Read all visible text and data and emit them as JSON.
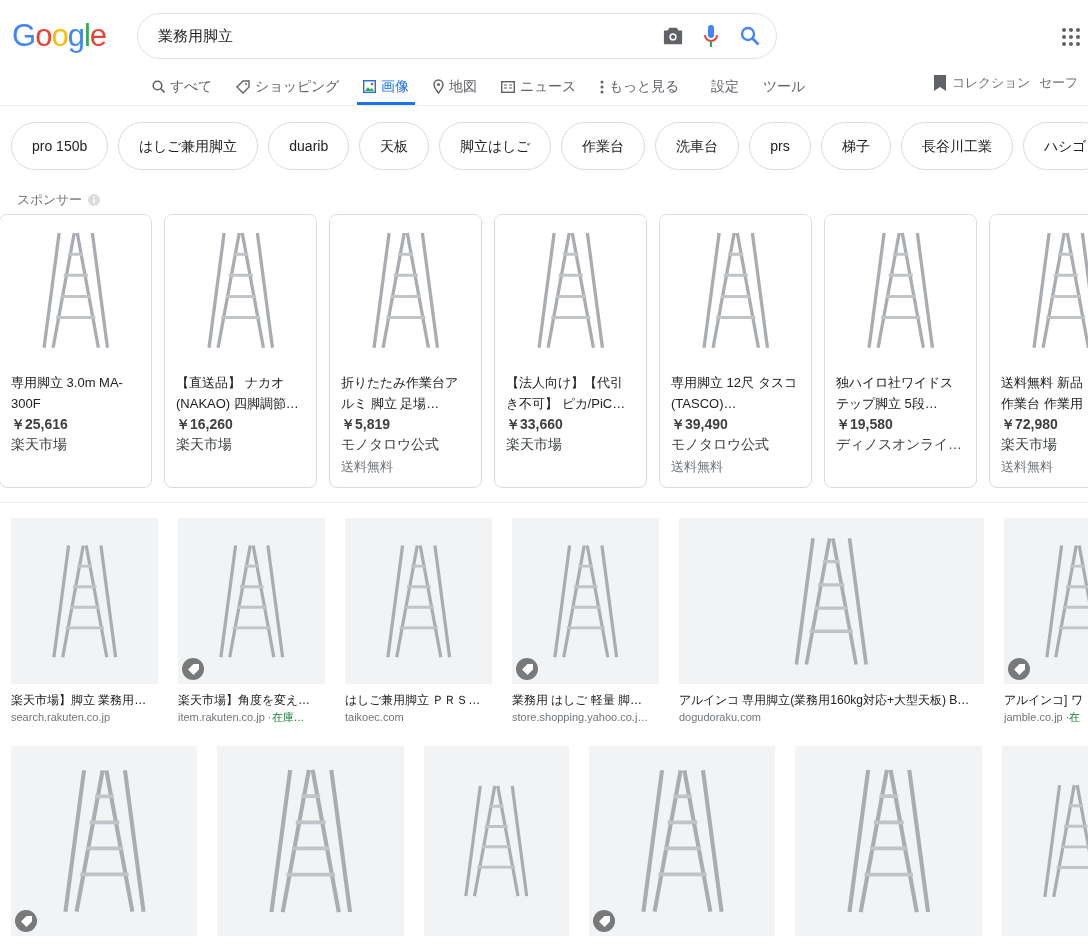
{
  "logo": "Google",
  "search": {
    "value": "業務用脚立"
  },
  "tabs": [
    {
      "label": "すべて",
      "selected": false
    },
    {
      "label": "ショッピング",
      "selected": false
    },
    {
      "label": "画像",
      "selected": true
    },
    {
      "label": "地図",
      "selected": false
    },
    {
      "label": "ニュース",
      "selected": false
    },
    {
      "label": "もっと見る",
      "selected": false
    },
    {
      "label": "設定",
      "selected": false
    },
    {
      "label": "ツール",
      "selected": false
    }
  ],
  "collections": "コレクション",
  "safesearch": "セーフ",
  "chips": [
    "pro 150b",
    "はしご兼用脚立",
    "duarib",
    "天板",
    "脚立はしご",
    "作業台",
    "洗車台",
    "prs",
    "梯子",
    "長谷川工業",
    "ハシゴ"
  ],
  "sponsored_label": "スポンサー",
  "sponsored": [
    {
      "title": "専用脚立 3.0m MA-300F",
      "price": "￥25,616",
      "store": "楽天市場"
    },
    {
      "title": "【直送品】 ナカオ (NAKAO) 四脚調節…",
      "price": "￥16,260",
      "store": "楽天市場"
    },
    {
      "title": "折りたたみ作業台アルミ 脚立 足場…",
      "price": "￥5,819",
      "store": "モノタロウ公式",
      "shipping": "送料無料"
    },
    {
      "title": "【法人向け】【代引き不可】 ピカ/PiC…",
      "price": "￥33,660",
      "store": "楽天市場"
    },
    {
      "title": "専用脚立 12尺 タスコ(TASCO)…",
      "price": "￥39,490",
      "store": "モノタロウ公式",
      "shipping": "送料無料"
    },
    {
      "title": "独ハイロ社ワイドステップ脚立 5段…",
      "price": "￥19,580",
      "store": "ディノスオンライ…"
    },
    {
      "title": "送料無料 新品作業台 作業用",
      "price": "￥72,980",
      "store": "楽天市場",
      "shipping": "送料無料"
    }
  ],
  "results": [
    {
      "title": "楽天市場】脚立 業務用…",
      "source": "search.rakuten.co.jp",
      "tagged": false
    },
    {
      "title": "楽天市場】角度を変え…",
      "source": "item.rakuten.co.jp · ",
      "stock": "在庫…",
      "tagged": true
    },
    {
      "title": "はしご兼用脚立 ＰＲＳ…",
      "source": "taikoec.com",
      "tagged": false
    },
    {
      "title": "業務用 はしご 軽量 脚…",
      "source": "store.shopping.yahoo.co.j…",
      "tagged": true
    },
    {
      "title": "アルインコ 専用脚立(業務用160kg対応+大型天板) B…",
      "source": "dogudoraku.com",
      "tagged": false
    },
    {
      "title": "アルインコ] ワ",
      "source": "jamble.co.jp · ",
      "stock": "在",
      "tagged": true
    }
  ],
  "more_results": [
    {
      "tagged": true
    },
    {
      "tagged": false
    },
    {
      "tagged": false
    },
    {
      "tagged": true
    },
    {
      "tagged": false
    },
    {
      "tagged": false
    }
  ]
}
